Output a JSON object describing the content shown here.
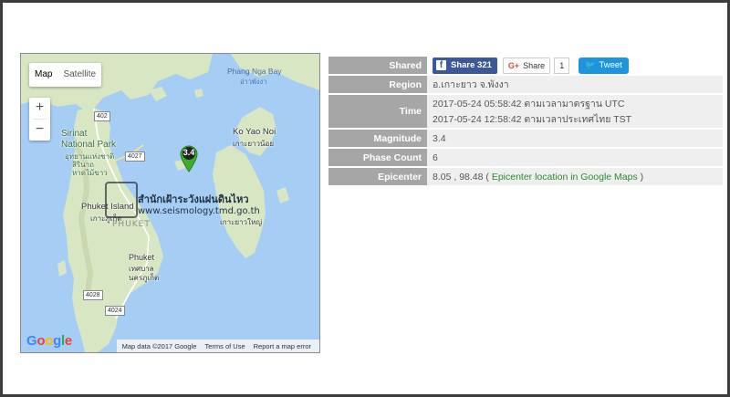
{
  "map": {
    "type_map": "Map",
    "type_satellite": "Satellite",
    "zoom_in": "+",
    "zoom_out": "−",
    "labels": {
      "phang_nga_bay_en": "Phang Nga Bay",
      "phang_nga_bay_th": "อ่าวพังงา",
      "sirinat_en_1": "Sirinat",
      "sirinat_en_2": "National Park",
      "sirinat_th_1": "อุทยานแห่งชาติ",
      "sirinat_th_2": "สิรินาถ",
      "sirinat_th_3": "หาดไม้ขาว",
      "ko_yao_noi_en": "Ko Yao Noi",
      "ko_yao_noi_th": "เกาะยาวน้อย",
      "phuket_island_en": "Phuket Island",
      "phuket_island_th": "เกาะภูเก็ต",
      "ko_yao_yai_th": "เกาะยาวใหญ่",
      "phuket_city_en": "Phuket",
      "phuket_city_th_1": "เทศบาล",
      "phuket_city_th_2": "นครภูเก็ต"
    },
    "roads": [
      "402",
      "4027",
      "4028",
      "4024"
    ],
    "watermark_title": "สำนักเฝ้าระวังแผ่นดินไหว",
    "watermark_url": "www.seismology.tmd.go.th",
    "watermark_sub": "PHUKET",
    "marker_magnitude": "3.4",
    "google_logo": "Google",
    "attribution": {
      "map_data": "Map data ©2017 Google",
      "terms": "Terms of Use",
      "report": "Report a map error"
    }
  },
  "info": {
    "shared": {
      "label": "Shared",
      "fb_label": "Share 321",
      "gplus_label": "Share",
      "gplus_count": "1",
      "tweet_label": "Tweet"
    },
    "region": {
      "label": "Region",
      "value": "อ.เกาะยาว จ.พังงา"
    },
    "time": {
      "label": "Time",
      "utc": "2017-05-24 05:58:42 ตามเวลามาตรฐาน UTC",
      "local": "2017-05-24 12:58:42 ตามเวลาประเทศไทย TST"
    },
    "magnitude": {
      "label": "Magnitude",
      "value": "3.4"
    },
    "phase_count": {
      "label": "Phase Count",
      "value": "6"
    },
    "epicenter": {
      "label": "Epicenter",
      "coords": "8.05 , 98.48",
      "open": "(",
      "link": "Epicenter location in Google Maps",
      "close": ")"
    }
  },
  "colors": {
    "water": "#a6cef5",
    "land": "#d8e6c4",
    "header_bg": "#a6a6a6",
    "facebook": "#3b5998",
    "twitter": "#1b95e0",
    "marker": "#3dae2b"
  }
}
